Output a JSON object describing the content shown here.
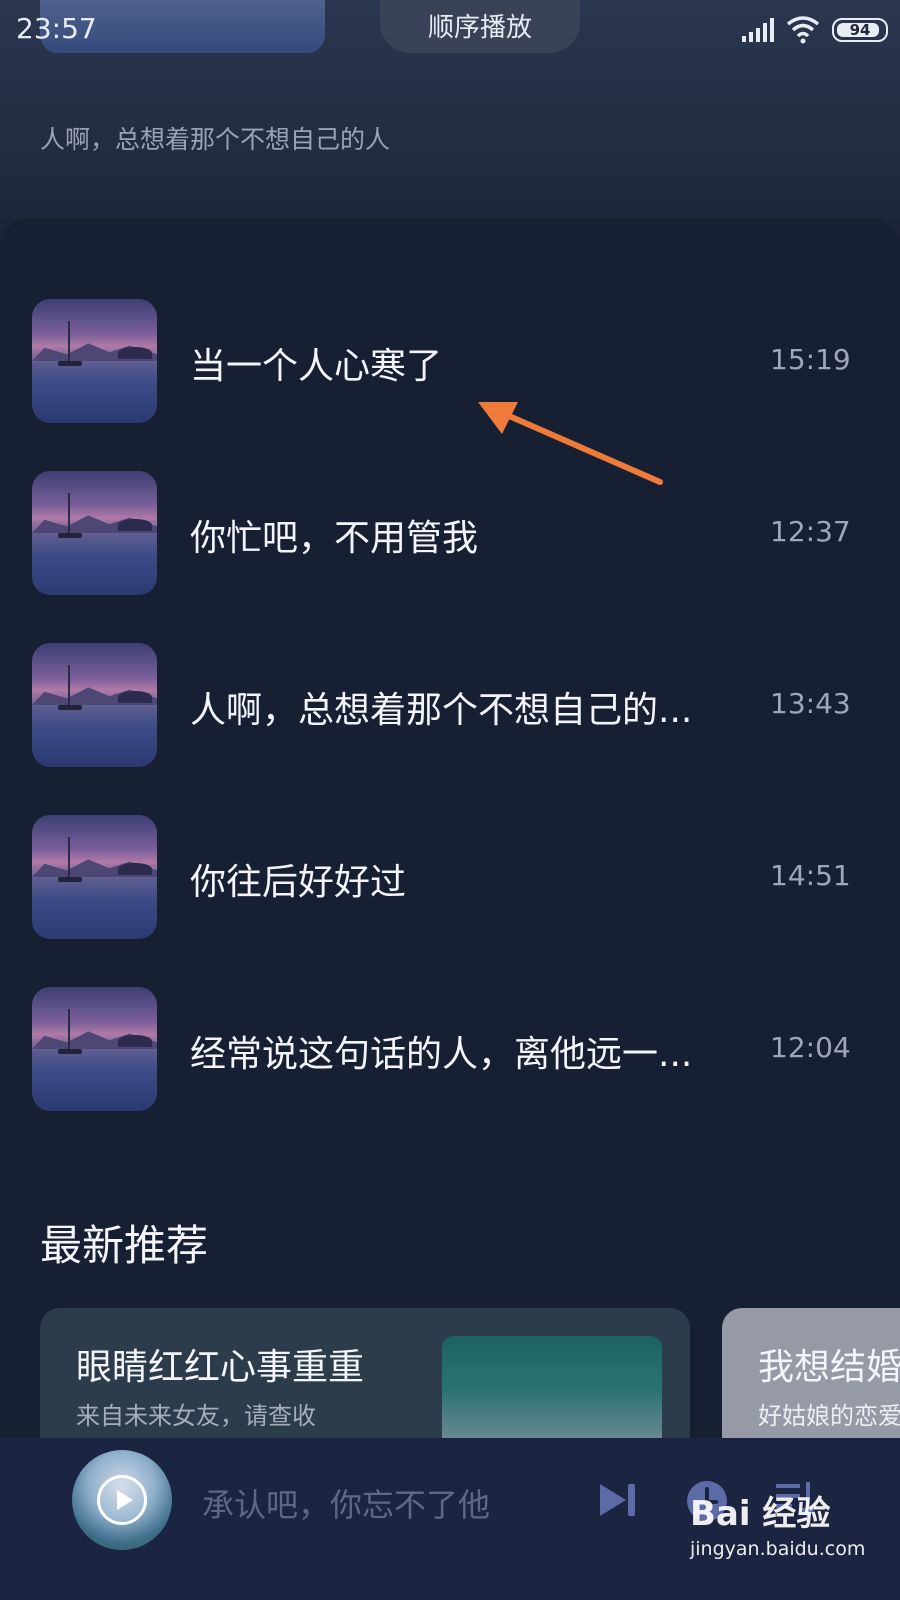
{
  "status_bar": {
    "time": "23:57",
    "battery": "94"
  },
  "header": {
    "play_mode": "顺序播放",
    "subtitle": "人啊，总想着那个不想自己的人"
  },
  "tracks": [
    {
      "title": "当一个人心寒了",
      "time": "15:19"
    },
    {
      "title": "你忙吧，不用管我",
      "time": "12:37"
    },
    {
      "title": "人啊，总想着那个不想自己的...",
      "time": "13:43"
    },
    {
      "title": "你往后好好过",
      "time": "14:51"
    },
    {
      "title": "经常说这句话的人，离他远一...",
      "time": "12:04"
    }
  ],
  "recommend": {
    "title": "最新推荐",
    "cards": [
      {
        "title": "眼睛红红心事重重",
        "subtitle": "来自未来女友，请查收"
      },
      {
        "title": "我想结婚",
        "subtitle": "好姑娘的恋爱"
      }
    ]
  },
  "player": {
    "now_playing": "承认吧，你忘不了他"
  },
  "watermark": {
    "logo": "Bai 经验",
    "url": "jingyan.baidu.com"
  },
  "colors": {
    "background": "#161d2f",
    "annotation_arrow": "#f07a3a",
    "player_bar": "#1b2440",
    "player_icon": "#5d6aa8"
  }
}
